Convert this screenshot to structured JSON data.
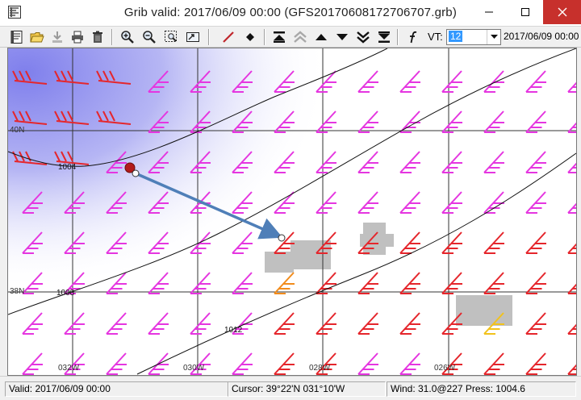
{
  "window": {
    "title": "Grib valid: 2017/06/09 00:00 (GFS20170608172706707.grb)"
  },
  "toolbar": {
    "vt_label": "VT:",
    "vt_value": "12",
    "date": "2017/06/09 00:00"
  },
  "map": {
    "lat_labels": [
      "40N",
      "38N"
    ],
    "lon_labels": [
      "032W",
      "030W",
      "028W",
      "026W"
    ],
    "isobar_labels": [
      "1004",
      "1008",
      "1012"
    ]
  },
  "status": {
    "valid": "Valid: 2017/06/09 00:00",
    "cursor": "Cursor: 39°22'N  031°10'W",
    "wind": "Wind: 31.0@227  Press: 1004.6"
  },
  "colors": {
    "barb_magenta": "#e536e0",
    "barb_red": "#e5262c",
    "barb_orange": "#f28c1c",
    "barb_yellow": "#f2c21c",
    "low_pressure_shade": "#8c8cf0",
    "route_arrow": "#4f7fb8",
    "grey_cells": "#c0c0c0"
  }
}
